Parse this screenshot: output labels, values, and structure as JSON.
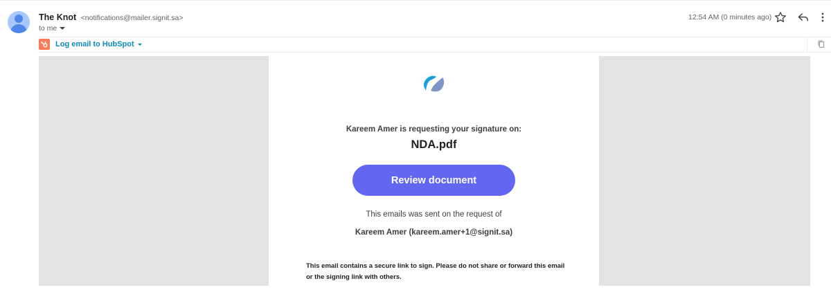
{
  "message": {
    "sender_name": "The Knot",
    "sender_email": "<notifications@mailer.signit.sa>",
    "recipient": "to me",
    "timestamp": "12:54 AM (0 minutes ago)"
  },
  "actions": {
    "star_icon": "star-outline-icon",
    "reply_icon": "reply-icon",
    "more_icon": "more-vertical-icon"
  },
  "hubspot": {
    "label": "Log email to HubSpot",
    "brand_color": "#ff7a59",
    "link_color": "#0a8bbd"
  },
  "email": {
    "request_line": "Kareem Amer is requesting your signature on:",
    "document_name": "NDA.pdf",
    "review_button": "Review document",
    "sent_note": "This emails was sent on the request of",
    "requester": "Kareem Amer (kareem.amer+1@signit.sa)",
    "security_note": "This email contains a secure link to sign. Please do not share or forward this email or the signing link with others.",
    "button_color": "#6366f1",
    "background_color": "#e3e3e3"
  }
}
